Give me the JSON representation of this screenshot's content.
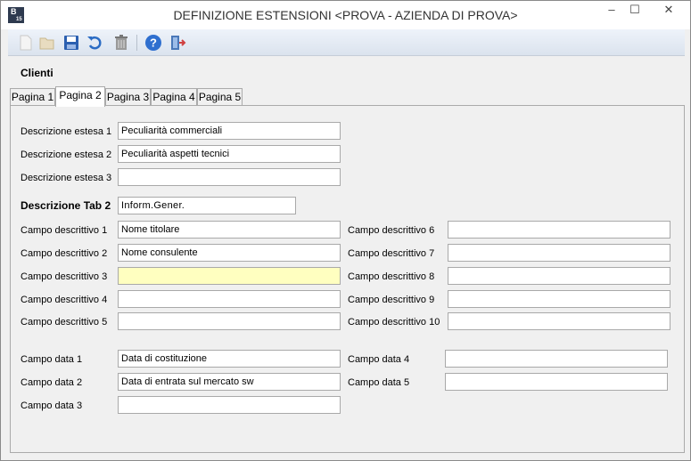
{
  "window": {
    "title": "DEFINIZIONE ESTENSIONI <PROVA - AZIENDA DI PROVA>",
    "icon_text": "B",
    "icon_sub": "15",
    "minimize": "–",
    "maximize": "☐",
    "close": "✕"
  },
  "section_title": "Clienti",
  "tabs": [
    "Pagina 1",
    "Pagina 2",
    "Pagina 3",
    "Pagina 4",
    "Pagina 5"
  ],
  "active_tab": "Pagina 2",
  "extended": [
    {
      "label": "Descrizione estesa 1",
      "value": "Peculiarità commerciali"
    },
    {
      "label": "Descrizione estesa 2",
      "value": "Peculiarità aspetti tecnici"
    },
    {
      "label": "Descrizione estesa 3",
      "value": ""
    }
  ],
  "tab_desc": {
    "label": "Descrizione Tab 2",
    "value": "Inform.Gener."
  },
  "campi_left": [
    {
      "label": "Campo descrittivo 1",
      "value": "Nome titolare"
    },
    {
      "label": "Campo descrittivo 2",
      "value": "Nome consulente"
    },
    {
      "label": "Campo descrittivo 3",
      "value": ""
    },
    {
      "label": "Campo descrittivo 4",
      "value": ""
    },
    {
      "label": "Campo descrittivo 5",
      "value": ""
    }
  ],
  "campi_right": [
    {
      "label": "Campo descrittivo 6",
      "value": ""
    },
    {
      "label": "Campo descrittivo 7",
      "value": ""
    },
    {
      "label": "Campo descrittivo 8",
      "value": ""
    },
    {
      "label": "Campo descrittivo 9",
      "value": ""
    },
    {
      "label": "Campo descrittivo 10",
      "value": ""
    }
  ],
  "data_left": [
    {
      "label": "Campo data 1",
      "value": "Data di costituzione"
    },
    {
      "label": "Campo data 2",
      "value": "Data di entrata sul mercato sw"
    },
    {
      "label": "Campo data 3",
      "value": ""
    }
  ],
  "data_right": [
    {
      "label": "Campo data 4",
      "value": ""
    },
    {
      "label": "Campo data 5",
      "value": ""
    }
  ],
  "toolbar_icons": [
    "new-icon",
    "open-icon",
    "save-icon",
    "undo-icon",
    "delete-icon",
    "help-icon",
    "exit-icon"
  ]
}
